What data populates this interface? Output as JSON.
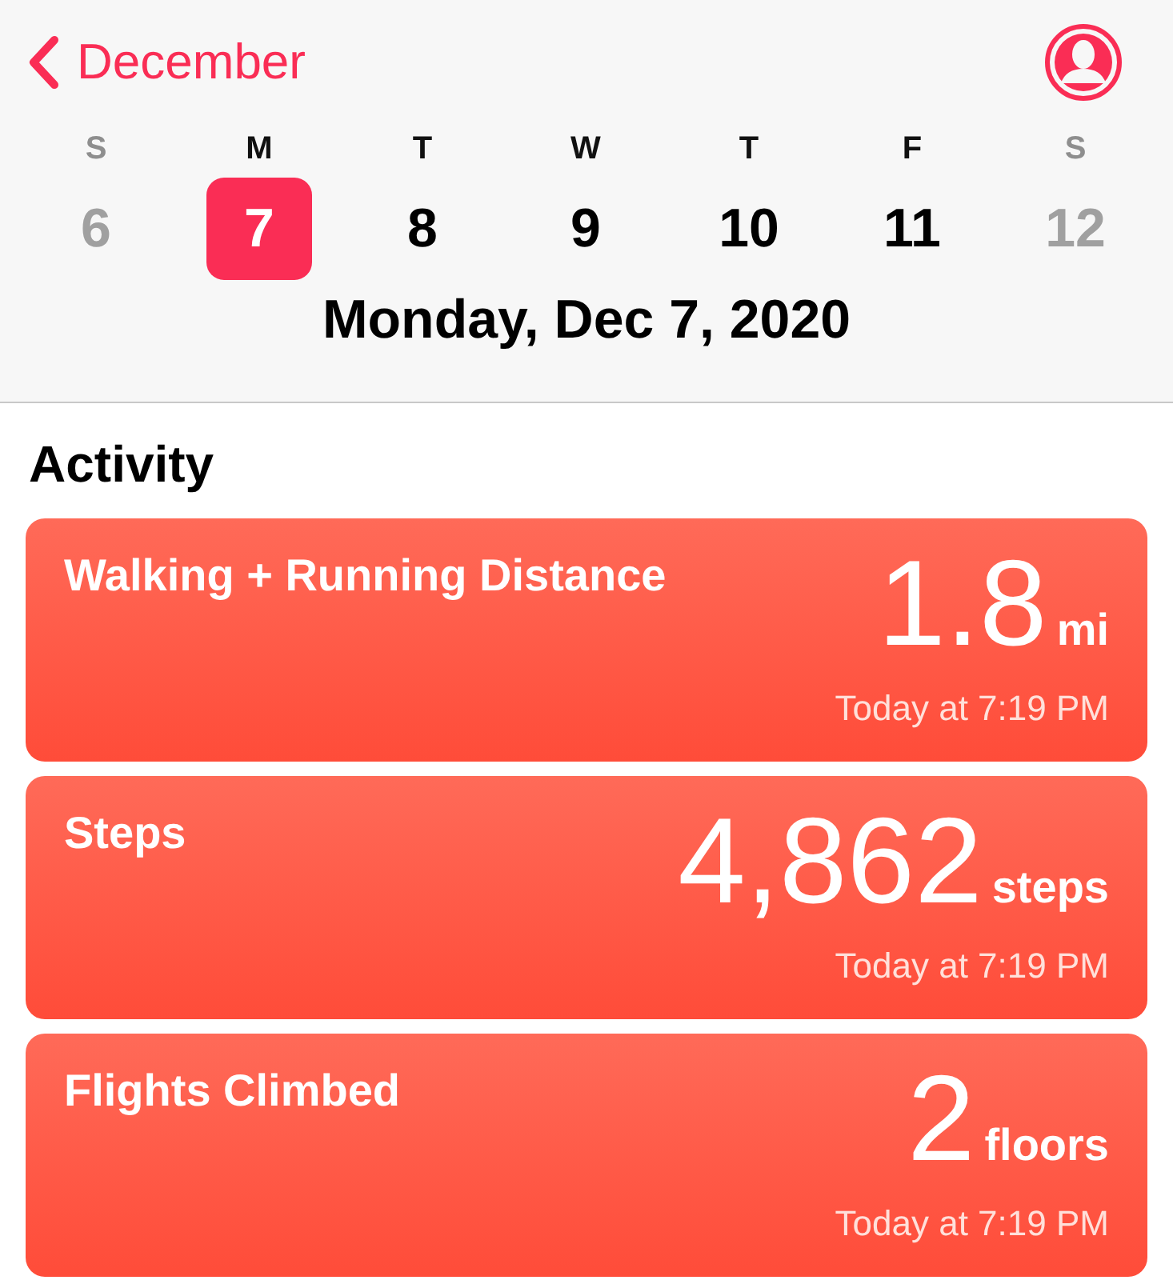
{
  "nav": {
    "back_label": "December"
  },
  "week": [
    {
      "letter": "S",
      "day": "6",
      "selected": false,
      "dimmed": true
    },
    {
      "letter": "M",
      "day": "7",
      "selected": true,
      "dimmed": false
    },
    {
      "letter": "T",
      "day": "8",
      "selected": false,
      "dimmed": false
    },
    {
      "letter": "W",
      "day": "9",
      "selected": false,
      "dimmed": false
    },
    {
      "letter": "T",
      "day": "10",
      "selected": false,
      "dimmed": false
    },
    {
      "letter": "F",
      "day": "11",
      "selected": false,
      "dimmed": false
    },
    {
      "letter": "S",
      "day": "12",
      "selected": false,
      "dimmed": true
    }
  ],
  "date_title": "Monday, Dec 7, 2020",
  "section_title": "Activity",
  "cards": [
    {
      "title": "Walking + Running Distance",
      "value": "1.8",
      "unit": "mi",
      "time": "Today at 7:19 PM"
    },
    {
      "title": "Steps",
      "value": "4,862",
      "unit": "steps",
      "time": "Today at 7:19 PM"
    },
    {
      "title": "Flights Climbed",
      "value": "2",
      "unit": "floors",
      "time": "Today at 7:19 PM"
    }
  ]
}
